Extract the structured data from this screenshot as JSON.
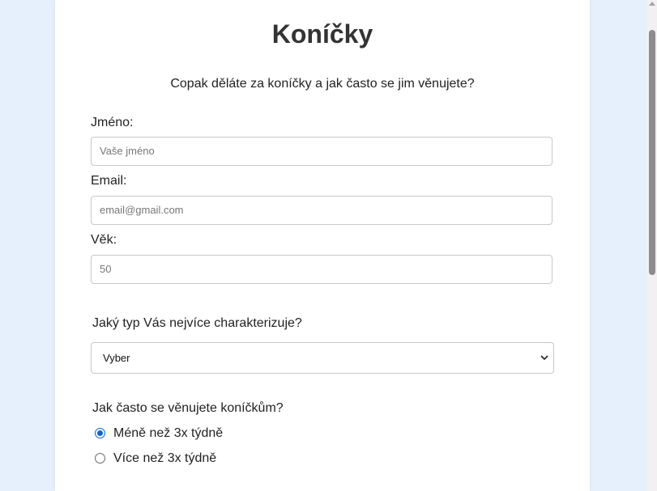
{
  "form": {
    "title": "Koníčky",
    "subtitle": "Copak děláte za koníčky a jak často se jim věnujete?",
    "name_label": "Jméno:",
    "name_placeholder": "Vaše jméno",
    "email_label": "Email:",
    "email_placeholder": "email@gmail.com",
    "age_label": "Věk:",
    "age_placeholder": "50",
    "type_question": "Jaký typ Vás nejvíce charakterizuje?",
    "type_selected": "Vyber",
    "frequency_question": "Jak často se věnujete koníčkům?",
    "frequency_options": [
      {
        "label": "Méně než 3x týdně",
        "checked": true
      },
      {
        "label": "Více než 3x týdně",
        "checked": false
      }
    ]
  },
  "colors": {
    "background": "#e6f0fc",
    "card": "#ffffff",
    "accent": "#0a66d8"
  }
}
